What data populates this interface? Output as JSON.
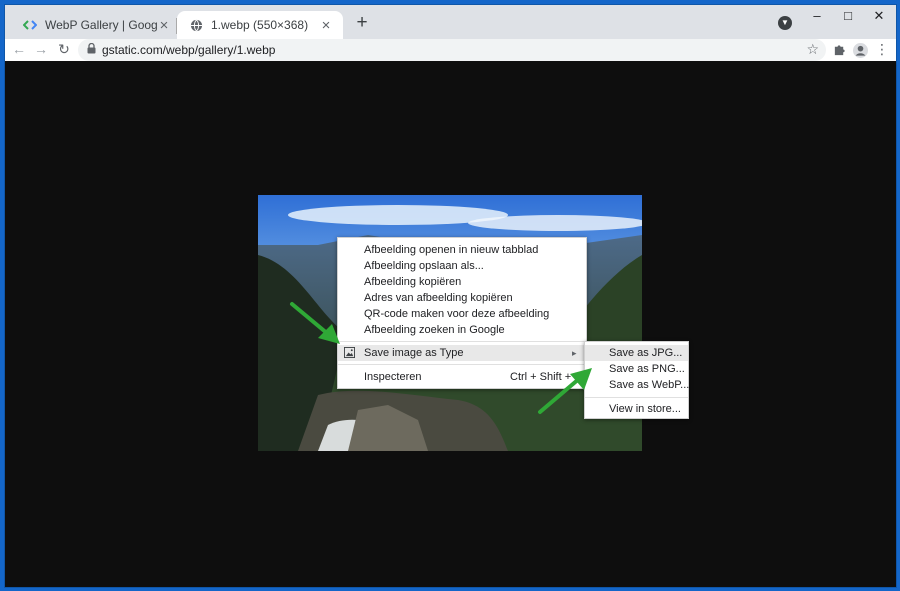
{
  "browser": {
    "tabs": [
      {
        "title": "WebP Gallery | Google Developers",
        "active": false
      },
      {
        "title": "1.webp (550×368)",
        "active": true
      }
    ],
    "new_tab": "+",
    "window_controls": {
      "minimize": "–",
      "maximize": "□",
      "close": "✕"
    },
    "address": "gstatic.com/webp/gallery/1.webp"
  },
  "context_menu": {
    "items": [
      "Afbeelding openen in nieuw tabblad",
      "Afbeelding opslaan als...",
      "Afbeelding kopiëren",
      "Adres van afbeelding kopiëren",
      "QR-code maken voor deze afbeelding",
      "Afbeelding zoeken in Google"
    ],
    "extension_item": {
      "label": "Save image as Type",
      "submenu_arrow": "▸"
    },
    "inspect": {
      "label": "Inspecteren",
      "shortcut": "Ctrl + Shift + I"
    }
  },
  "submenu": {
    "items": [
      "Save as JPG...",
      "Save as PNG...",
      "Save as WebP..."
    ],
    "store": "View in store..."
  },
  "colors": {
    "accent_arrow": "#2fa836",
    "menu_highlight": "#e8e8e8",
    "page_bg": "#0e0e0e"
  }
}
